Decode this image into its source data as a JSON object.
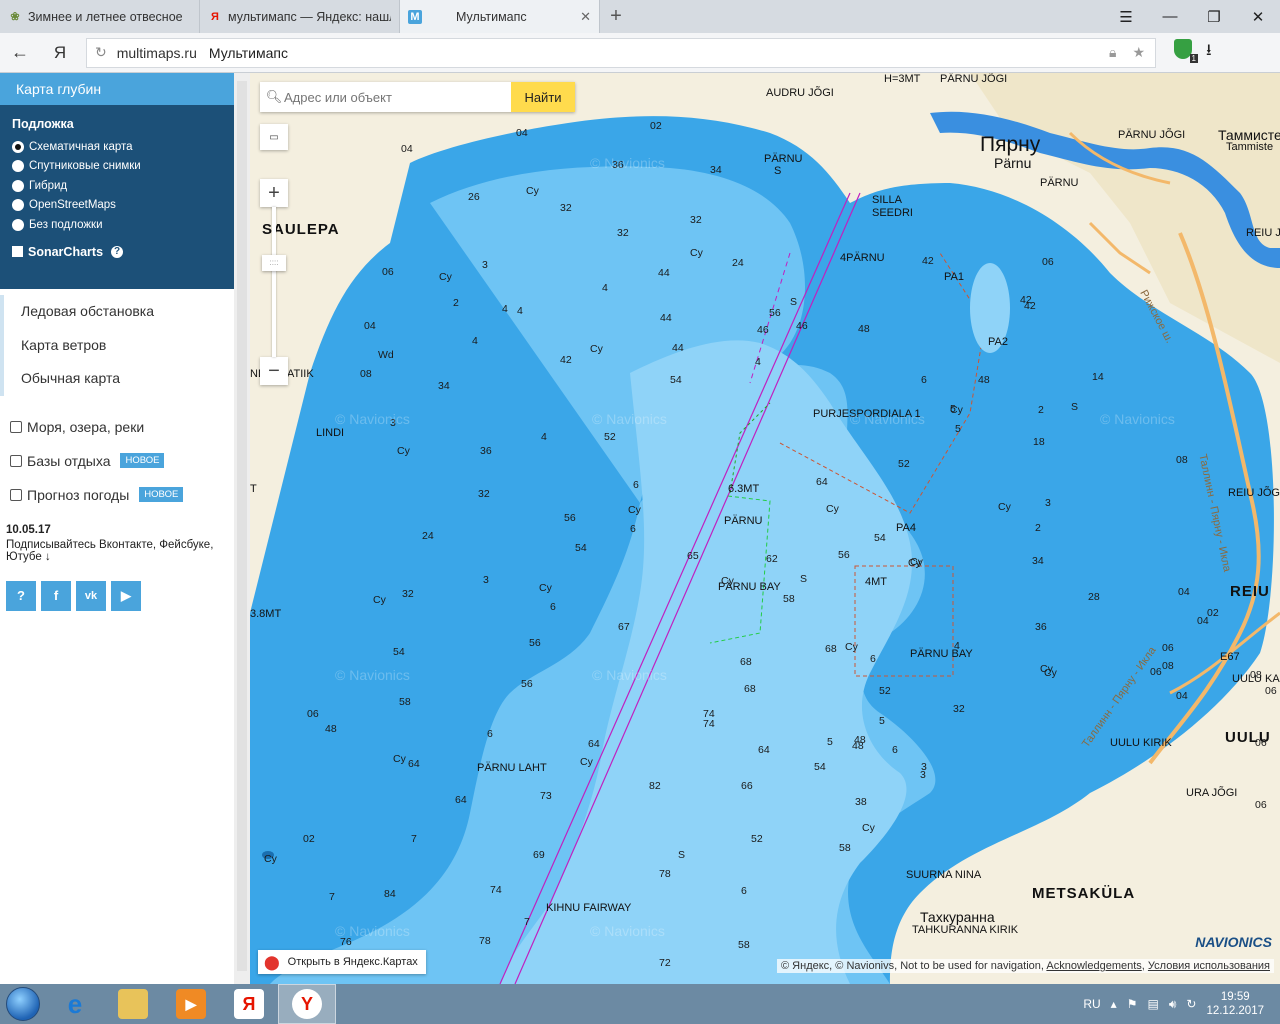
{
  "browser": {
    "tabs": [
      {
        "title": "Зимнее и летнее отвесное",
        "icon": "generic"
      },
      {
        "title": "мультимапс — Яндекс: нашлось",
        "icon": "yandex"
      },
      {
        "title": "Мультимапс",
        "icon": "multimaps"
      }
    ],
    "url_domain": "multimaps.ru",
    "page_title": "Мультимапс",
    "shield_badge": "1"
  },
  "sidebar": {
    "header": "Карта глубин",
    "basemap_title": "Подложка",
    "basemap_options": [
      {
        "label": "Схематичная карта",
        "selected": true
      },
      {
        "label": "Спутниковые снимки",
        "selected": false
      },
      {
        "label": "Гибрид",
        "selected": false
      },
      {
        "label": "OpenStreetMaps",
        "selected": false
      },
      {
        "label": "Без подложки",
        "selected": false
      }
    ],
    "sonar_label": "SonarCharts",
    "links": [
      "Ледовая обстановка",
      "Карта ветров",
      "Обычная карта"
    ],
    "categories": [
      {
        "label": "Моря, озера, реки",
        "badge": ""
      },
      {
        "label": "Базы отдыха",
        "badge": "НОВОЕ"
      },
      {
        "label": "Прогноз погоды",
        "badge": "НОВОЕ"
      }
    ],
    "news_date": "10.05.17",
    "news_text": "Подписывайтесь Вконтакте, Фейсбуке, Ютубе ↓",
    "social": [
      "?",
      "f",
      "vk",
      "▶"
    ]
  },
  "map": {
    "search_placeholder": "Адрес или объект",
    "search_button": "Найти",
    "zoom_in": "+",
    "zoom_out": "−",
    "open_yandex": "Открыть в Яндекс.Картах",
    "copyright_prefix": "© Яндекс, © Navionivs, Not to be used for navigation, ",
    "copyright_link1": "Acknowledgements",
    "copyright_link2": "Условия использования",
    "navionics_logo": "NAVIONICS",
    "watermark": "© Navionics",
    "labels": {
      "saulepa": "SAULEPA",
      "parnu_ru": "Пярну",
      "parnu_et": "Pärnu",
      "parnu_small": "PÄRNU",
      "audru": "AUDRU JÕGI",
      "h3mt": "H=3MT",
      "parnu_jogi_top": "PÄRNU JÕGI",
      "parnu_jogi_right": "PÄRNU JÕGI",
      "tammiste_ru": "Таммисте",
      "tammiste": "Tammiste",
      "reiu_jogi_top": "REIU JÕ",
      "riga_road": "Рижское ш.",
      "tallinn_road": "Таллинн - Пярну - Икла",
      "tallinn_road2": "Таллинн - Пярну - Икла",
      "reiu": "REIU",
      "reiu_jogi": "REIU JÕGI",
      "uulu": "UULU",
      "uulu_kab": "UULU KAI",
      "uulu_kirik": "UULU KIRIK",
      "ura_jogi": "URA JÕGI",
      "metsakula": "METSAKÜLA",
      "takhkuranna": "Тахкуранна",
      "tahkuranna_kirik": "TAHKURANNA KIRIK",
      "suurna_nina": "SUURNA NINA",
      "parnu_laht": "PÄRNU LAHT",
      "parnu_bay": "PÄRNU BAY",
      "parnu_bay2": "PÄRNU BAY",
      "kihnu": "KIHNU FAIRWAY",
      "parnu_s": "PÄRNU",
      "parnu_s2": "S",
      "silla": "SILLA",
      "seedri": "SEEDRI",
      "parnu_4": "4PÄRNU",
      "pa1": "PA1",
      "pa2": "PA2",
      "pa4": "PA4",
      "purjespordiala": "PURJESPORDIALA 1",
      "mt63": "6.3MT",
      "parnu_mt": "PÄRNU",
      "mt4": "4MT",
      "lindi": "LINDI",
      "atiik": "ATIIK",
      "nd": "ND",
      "mt38": "3.8MT",
      "e67": "E67",
      "t_edge": "T"
    },
    "depths": [
      {
        "t": "04"
      },
      {
        "t": "02"
      },
      {
        "t": "36"
      },
      {
        "t": "34"
      },
      {
        "t": "04"
      },
      {
        "t": "Cy"
      },
      {
        "t": "26"
      },
      {
        "t": "32"
      },
      {
        "t": "32"
      },
      {
        "t": "32"
      },
      {
        "t": "Cy"
      },
      {
        "t": "44"
      },
      {
        "t": "44"
      },
      {
        "t": "24"
      },
      {
        "t": "Cy"
      },
      {
        "t": "3"
      },
      {
        "t": "4"
      },
      {
        "t": "4"
      },
      {
        "t": "06"
      },
      {
        "t": "2"
      },
      {
        "t": "4"
      },
      {
        "t": "44"
      },
      {
        "t": "46"
      },
      {
        "t": "04"
      },
      {
        "t": "Wd"
      },
      {
        "t": "4"
      },
      {
        "t": "42"
      },
      {
        "t": "Cy"
      },
      {
        "t": "08"
      },
      {
        "t": "34"
      },
      {
        "t": "54"
      },
      {
        "t": "3"
      },
      {
        "t": "Cy"
      },
      {
        "t": "4"
      },
      {
        "t": "52"
      },
      {
        "t": "36"
      },
      {
        "t": "32"
      },
      {
        "t": "54"
      },
      {
        "t": "6"
      },
      {
        "t": "Cy"
      },
      {
        "t": "56"
      },
      {
        "t": "6"
      },
      {
        "t": "24"
      },
      {
        "t": "3"
      },
      {
        "t": "Cy"
      },
      {
        "t": "32"
      },
      {
        "t": "Cy"
      },
      {
        "t": "6"
      },
      {
        "t": "54"
      },
      {
        "t": "56"
      },
      {
        "t": "56"
      },
      {
        "t": "58"
      },
      {
        "t": "6"
      },
      {
        "t": "48"
      },
      {
        "t": "Cy"
      },
      {
        "t": "64"
      },
      {
        "t": "PÄRNU LAHT"
      },
      {
        "t": "74"
      },
      {
        "t": "73"
      },
      {
        "t": "64"
      },
      {
        "t": "82"
      },
      {
        "t": "Cy"
      },
      {
        "t": "64"
      },
      {
        "t": "7"
      },
      {
        "t": "69"
      },
      {
        "t": "S"
      },
      {
        "t": "78"
      },
      {
        "t": "6"
      },
      {
        "t": "84"
      },
      {
        "t": "7"
      },
      {
        "t": "74"
      },
      {
        "t": "78"
      },
      {
        "t": "7"
      },
      {
        "t": "76"
      },
      {
        "t": "72"
      },
      {
        "t": "58"
      },
      {
        "t": "67"
      },
      {
        "t": "68"
      },
      {
        "t": "65"
      },
      {
        "t": "Cy"
      },
      {
        "t": "62"
      },
      {
        "t": "58"
      },
      {
        "t": "68"
      },
      {
        "t": "6"
      },
      {
        "t": "68"
      },
      {
        "t": "74"
      },
      {
        "t": "64"
      },
      {
        "t": "66"
      },
      {
        "t": "52"
      },
      {
        "t": "5"
      },
      {
        "t": "6"
      },
      {
        "t": "42"
      },
      {
        "t": "48"
      },
      {
        "t": "6"
      },
      {
        "t": "5"
      },
      {
        "t": "48"
      },
      {
        "t": "46"
      },
      {
        "t": "S"
      },
      {
        "t": "56"
      },
      {
        "t": "4"
      },
      {
        "t": "64"
      },
      {
        "t": "Cy"
      },
      {
        "t": "54"
      },
      {
        "t": "52"
      },
      {
        "t": "56"
      },
      {
        "t": "Cy"
      },
      {
        "t": "Cy"
      },
      {
        "t": "3"
      },
      {
        "t": "4"
      },
      {
        "t": "Cy"
      },
      {
        "t": "52"
      },
      {
        "t": "32"
      },
      {
        "t": "5"
      },
      {
        "t": "48"
      },
      {
        "t": "54"
      },
      {
        "t": "3"
      },
      {
        "t": "38"
      },
      {
        "t": "Cy"
      },
      {
        "t": "58"
      },
      {
        "t": "42"
      },
      {
        "t": "06"
      },
      {
        "t": "42"
      },
      {
        "t": "14"
      },
      {
        "t": "2"
      },
      {
        "t": "S"
      },
      {
        "t": "18"
      },
      {
        "t": "08"
      },
      {
        "t": "2"
      },
      {
        "t": "3"
      },
      {
        "t": "Cy"
      },
      {
        "t": "34"
      },
      {
        "t": "28"
      },
      {
        "t": "36"
      },
      {
        "t": "Cy"
      },
      {
        "t": "04"
      },
      {
        "t": "02"
      },
      {
        "t": "06"
      },
      {
        "t": "08"
      },
      {
        "t": "04"
      },
      {
        "t": "06"
      },
      {
        "t": "Cy"
      },
      {
        "t": "06"
      },
      {
        "t": "08"
      },
      {
        "t": "06"
      },
      {
        "t": "04"
      },
      {
        "t": "06"
      },
      {
        "t": "48"
      },
      {
        "t": "S"
      },
      {
        "t": "5"
      },
      {
        "t": "Cy"
      },
      {
        "t": "06"
      },
      {
        "t": "02"
      },
      {
        "t": "Cy"
      }
    ]
  },
  "taskbar": {
    "lang": "RU",
    "time": "19:59",
    "date": "12.12.2017",
    "apps": [
      "ie",
      "explorer",
      "media",
      "yandex-browser",
      "yandex"
    ]
  }
}
